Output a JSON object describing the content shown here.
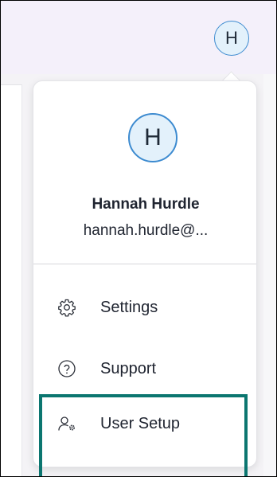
{
  "header": {
    "avatar_initial": "H"
  },
  "user_menu": {
    "avatar_initial": "H",
    "name": "Hannah Hurdle",
    "email": "hannah.hurdle@...",
    "items": [
      {
        "label": "Settings",
        "icon": "gear-icon"
      },
      {
        "label": "Support",
        "icon": "question-circle-icon"
      },
      {
        "label": "User Setup",
        "icon": "user-gear-icon"
      }
    ]
  },
  "colors": {
    "avatar_border": "#3d8bd0",
    "avatar_fill": "#e3f1fb",
    "highlight_border": "#0b7670",
    "topbar_bg": "#f4f0fa"
  }
}
